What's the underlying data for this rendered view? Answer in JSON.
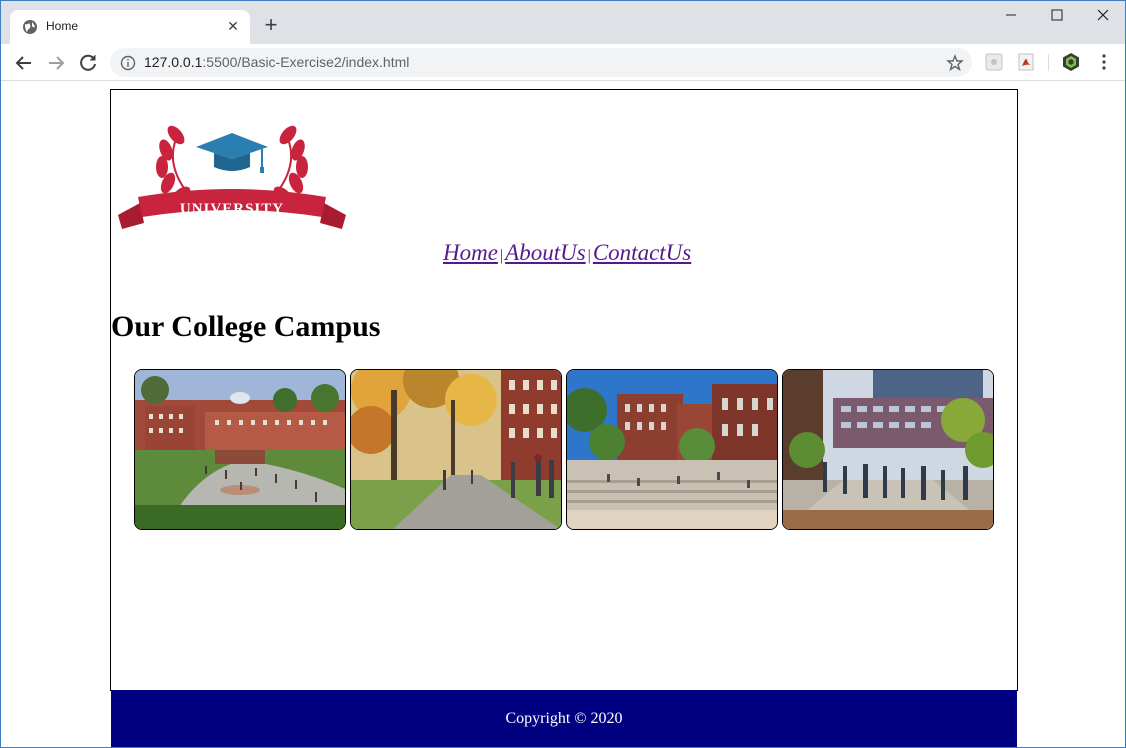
{
  "browser": {
    "tab_title": "Home",
    "new_tab_label": "+",
    "url_host": "127.0.0.1",
    "url_rest": ":5500/Basic-Exercise2/index.html"
  },
  "page": {
    "logo": {
      "text": "UNIVERSITY"
    },
    "nav": {
      "links": [
        "Home",
        "AboutUs",
        "ContactUs"
      ],
      "separator": "|"
    },
    "heading": "Our College Campus",
    "gallery": [
      "campus-photo-1",
      "campus-photo-2",
      "campus-photo-3",
      "campus-photo-4"
    ],
    "footer": "Copyright © 2020"
  },
  "colors": {
    "footer_bg": "#000080",
    "link": "#551a8b",
    "logo_red": "#c8243e",
    "logo_blue": "#2a7fb0"
  }
}
